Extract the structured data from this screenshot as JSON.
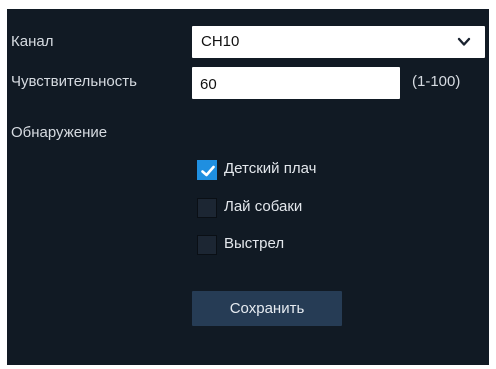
{
  "form": {
    "channel_label": "Канал",
    "channel_value": "CH10",
    "sensitivity_label": "Чувствительность",
    "sensitivity_value": "60",
    "sensitivity_range": "(1-100)",
    "detection_label": "Обнаружение"
  },
  "detection_options": [
    {
      "label": "Детский плач",
      "checked": true
    },
    {
      "label": "Лай собаки",
      "checked": false
    },
    {
      "label": "Выстрел",
      "checked": false
    }
  ],
  "actions": {
    "save_label": "Сохранить"
  },
  "colors": {
    "panel_bg": "#111a24",
    "checkbox_checked": "#1f8fe0",
    "button_bg": "#263c55"
  },
  "icons": {
    "dropdown": "chevron-down-icon",
    "checked": "checkmark-icon"
  }
}
